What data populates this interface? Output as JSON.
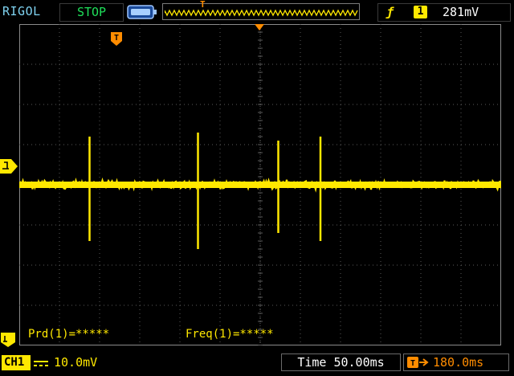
{
  "brand": "RIGOL",
  "run_status": "STOP",
  "colors": {
    "channel1": "#ffe800",
    "trigger": "#ff8c00",
    "run_status": "#1fe05a",
    "brand": "#7fd2f0",
    "grid": "#5a5a5a"
  },
  "icons": {
    "memory": "battery-memory-icon",
    "trigger_edge": "rising-edge-icon",
    "coupling": "dc-coupling-icon",
    "trigger_offset": "trigger-offset-arrow-icon"
  },
  "memory_strip": {
    "trigger_marker": "T"
  },
  "trigger": {
    "edge_symbol": "ƒ",
    "source": "1",
    "level": "281mV"
  },
  "screen": {
    "trigger_label": "T"
  },
  "measurements": {
    "prd": "Prd(1)=*****",
    "freq": "Freq(1)=*****"
  },
  "channel": {
    "label": "CH1",
    "scale": "10.0mV"
  },
  "timebase": "Time 50.00ms",
  "trigger_offset": "180.0ms",
  "waveform": {
    "baseline_div": 0,
    "noise_div": 0.18,
    "spikes": [
      {
        "time_div": 1.75,
        "up_div": 1.2,
        "down_div": 1.4
      },
      {
        "time_div": 4.45,
        "up_div": 1.3,
        "down_div": 1.6
      },
      {
        "time_div": 6.45,
        "up_div": 1.1,
        "down_div": 1.2
      },
      {
        "time_div": 7.5,
        "up_div": 1.2,
        "down_div": 1.4
      }
    ]
  }
}
